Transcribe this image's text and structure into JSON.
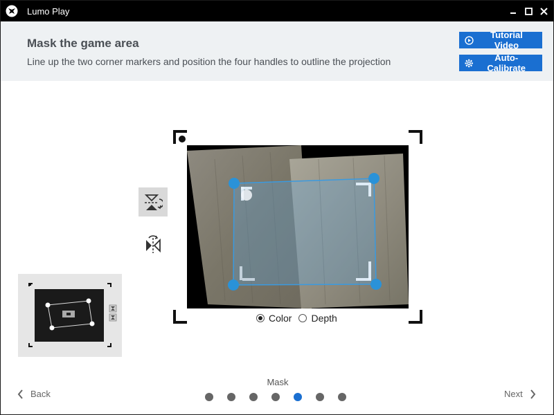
{
  "app": {
    "title": "Lumo Play"
  },
  "window_controls": {
    "minimize": "minimize-icon",
    "maximize": "maximize-icon",
    "close": "close-icon"
  },
  "header": {
    "title": "Mask the game area",
    "subtitle": "Line up the two corner markers and position the four handles to outline the projection",
    "tutorial_label": "Tutorial Video",
    "calibrate_label": "Auto-Calibrate"
  },
  "view_modes": {
    "color_label": "Color",
    "depth_label": "Depth",
    "selected": "Color"
  },
  "steps": {
    "current_label": "Mask",
    "total": 7,
    "current_index": 5
  },
  "nav": {
    "back_label": "Back",
    "next_label": "Next"
  },
  "colors": {
    "accent": "#1a6fd1",
    "handle": "#2a92d8",
    "dot_inactive": "#666666"
  }
}
